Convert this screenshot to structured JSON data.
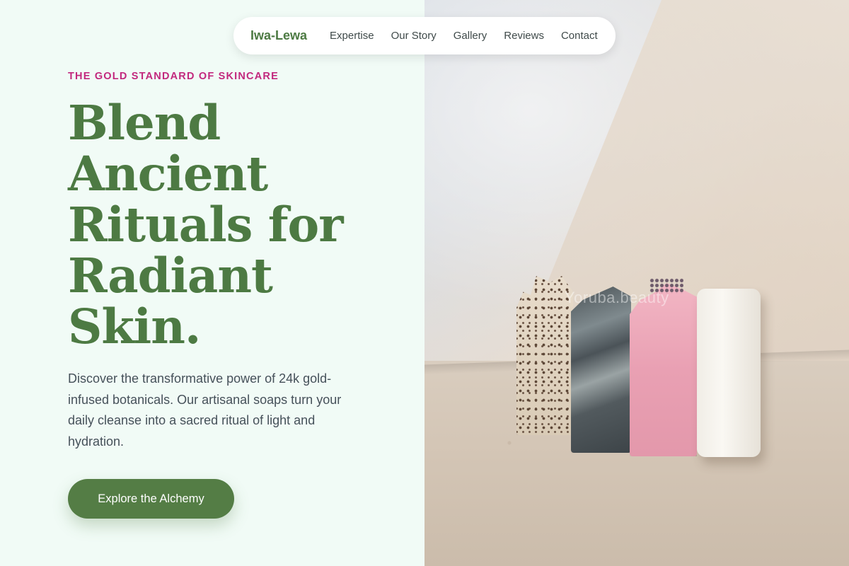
{
  "nav": {
    "brand": "Iwa-Lewa",
    "links": [
      "Expertise",
      "Our Story",
      "Gallery",
      "Reviews",
      "Contact"
    ]
  },
  "hero": {
    "eyebrow": "THE GOLD STANDARD OF SKINCARE",
    "headline_lines": [
      "Blend",
      "Ancient",
      "Rituals for",
      "Radiant",
      "Skin."
    ],
    "lede": "Discover the transformative power of 24k gold-infused botanicals. Our artisanal soaps turn your daily cleanse into a sacred ritual of light and hydration.",
    "cta_label": "Explore the Alchemy"
  },
  "image": {
    "watermark": "Yoruba.beauty"
  },
  "colors": {
    "accent_green": "#4d7a43",
    "eyebrow_magenta": "#c2287d",
    "panel_bg": "#f1fbf6"
  }
}
